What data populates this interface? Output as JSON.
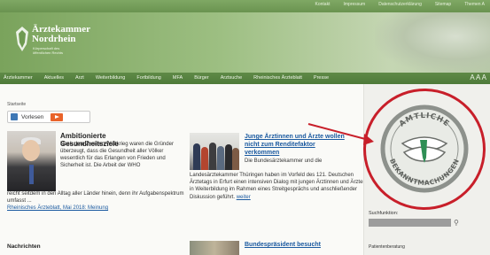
{
  "toplinks": [
    "Kontakt",
    "Impressum",
    "Datenschutzerklärung",
    "Sitemap",
    "Themen A"
  ],
  "logo": {
    "line1": "Ärztekammer",
    "line2": "Nordrhein",
    "sub": "Körperschaft des öffentlichen Rechts"
  },
  "nav": [
    "Ärztekammer",
    "Aktuelles",
    "Arzt",
    "Weiterbildung",
    "Fortbildung",
    "MFA",
    "Bürger",
    "Arztsuche",
    "Rheinisches Ärzteblatt",
    "Presse"
  ],
  "nav_tools": "A A A",
  "breadcrumb": "Startseite",
  "vorlesen_label": "Vorlesen",
  "article1": {
    "title": "Ambitionierte Gesundheitsziele",
    "text": "Nach dem Zweiten Weltkrieg waren die Gründer überzeugt, dass die Gesundheit aller Völker wesentlich für das Erlangen von Frieden und Sicherheit ist. Die Arbeit der WHO",
    "text2": "reicht seitdem in den Alltag aller Länder hinein, denn ihr Aufgabenspektrum umfasst ...",
    "link": "Rheinisches Ärzteblatt, Mai 2018: Meinung"
  },
  "article2": {
    "title": "Junge Ärztinnen und Ärzte wollen nicht zum Renditefaktor verkommen",
    "text": "Die Bundesärztekammer und die",
    "text2": "Landesärztekammer Thüringen haben im Vorfeld des 121. Deutschen Ärztetags in Erfurt einen intensiven Dialog mit jungen Ärztinnen und Ärzten in Weiterbildung im Rahmen eines Streitgesprächs und anschließender Diskussion geführt.",
    "link": "weiter"
  },
  "article3": {
    "title": "Bundespräsident besucht"
  },
  "section_news": "Nachrichten",
  "sidebar": {
    "search_label": "Suchfunktion:",
    "search_placeholder": "",
    "list_item": "Patientenberatung"
  },
  "stamp": {
    "top_text": "AMTLICHE",
    "bottom_text": "BEKANNTMACHUNGEN"
  },
  "colors": {
    "brand_green": "#5f8a47",
    "link_blue": "#1b5aa0",
    "accent_red": "#c81f2a",
    "play_orange": "#e9632a"
  }
}
